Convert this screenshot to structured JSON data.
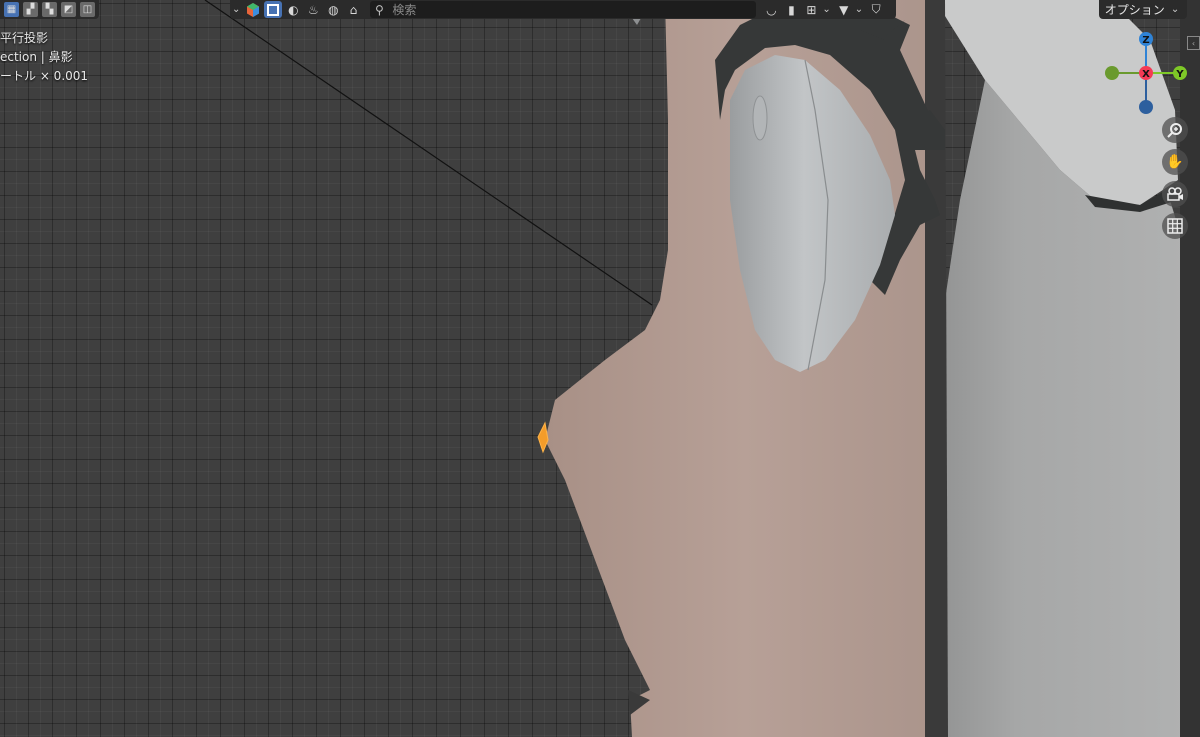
{
  "overlay": {
    "view_mode": "平行投影",
    "collection": "ection | 鼻影",
    "scale": "ートル × 0.001"
  },
  "header": {
    "search": {
      "placeholder": "検索",
      "value": ""
    },
    "options_label": "オプション",
    "icons": [
      "view-layer-icon",
      "object-icon",
      "material-icon",
      "scene-icon",
      "world-icon",
      "brush-icon"
    ]
  },
  "gizmo": {
    "axes": {
      "x": "X",
      "y": "Y",
      "z": "Z"
    },
    "colors": {
      "x": "#f53a55",
      "y": "#7ec827",
      "z": "#2f83d6",
      "neg_x": "#a8364a",
      "neg_y": "#6a9a2e",
      "neg_z": "#2d5f9e"
    }
  },
  "nav_buttons": [
    "zoom-icon",
    "hand-icon",
    "camera-icon",
    "grid-icon"
  ],
  "colors": {
    "viewport_bg": "#3f3f3f",
    "skin": "#b39c92",
    "hair": "#363838",
    "eye": "#bfc2c4",
    "cloth": "#a7a8a8",
    "selected": "#f39c2a",
    "header_bg": "#2b2b2b",
    "accent": "#4772b3"
  }
}
